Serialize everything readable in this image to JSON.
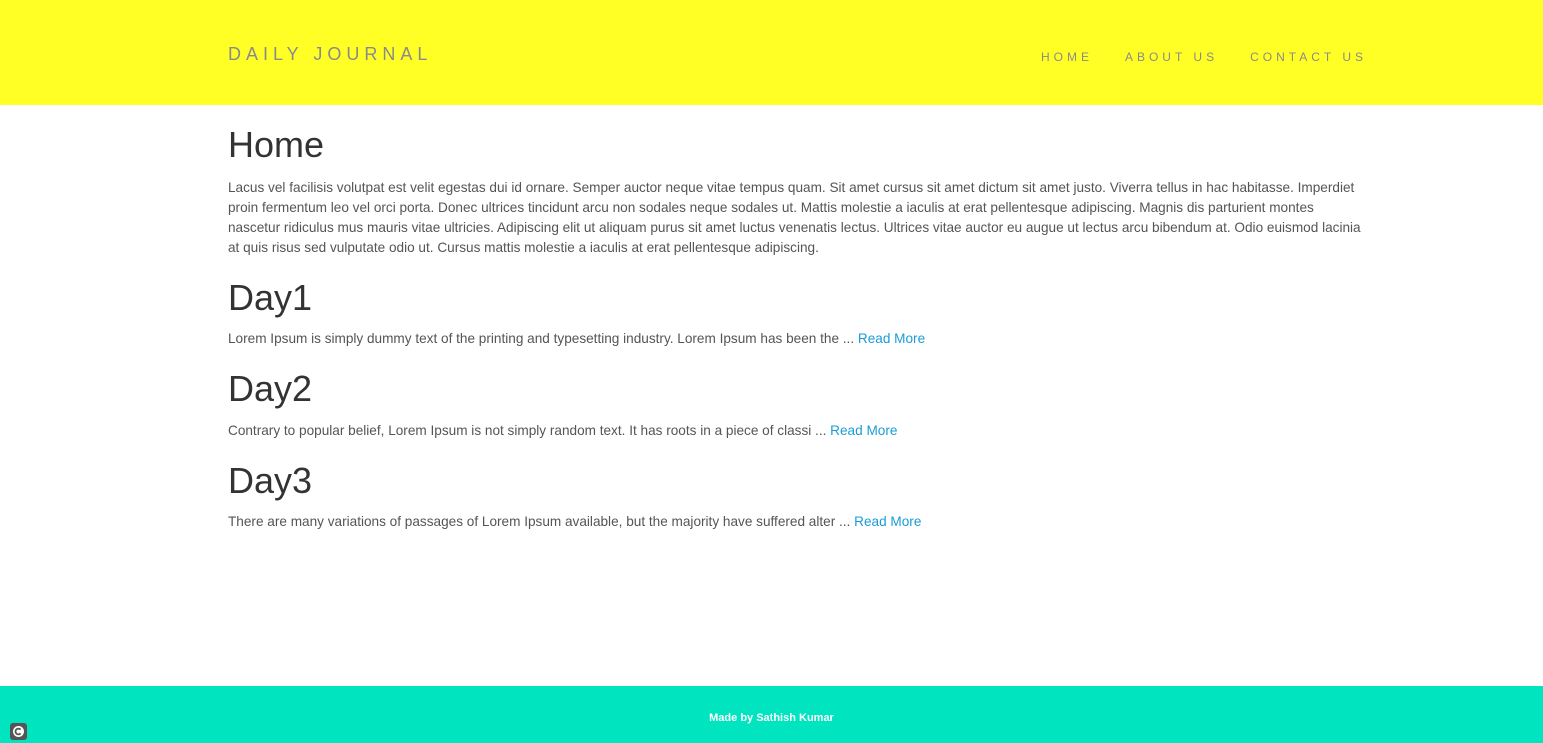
{
  "header": {
    "brand": "DAILY JOURNAL",
    "nav": [
      {
        "label": "HOME"
      },
      {
        "label": "ABOUT US"
      },
      {
        "label": "CONTACT US"
      }
    ]
  },
  "home": {
    "title": "Home",
    "text": "Lacus vel facilisis volutpat est velit egestas dui id ornare. Semper auctor neque vitae tempus quam. Sit amet cursus sit amet dictum sit amet justo. Viverra tellus in hac habitasse. Imperdiet proin fermentum leo vel orci porta. Donec ultrices tincidunt arcu non sodales neque sodales ut. Mattis molestie a iaculis at erat pellentesque adipiscing. Magnis dis parturient montes nascetur ridiculus mus mauris vitae ultricies. Adipiscing elit ut aliquam purus sit amet luctus venenatis lectus. Ultrices vitae auctor eu augue ut lectus arcu bibendum at. Odio euismod lacinia at quis risus sed vulputate odio ut. Cursus mattis molestie a iaculis at erat pellentesque adipiscing."
  },
  "posts": [
    {
      "title": "Day1",
      "excerpt": "Lorem Ipsum is simply dummy text of the printing and typesetting industry. Lorem Ipsum has been the ... ",
      "link": "Read More"
    },
    {
      "title": "Day2",
      "excerpt": "Contrary to popular belief, Lorem Ipsum is not simply random text. It has roots in a piece of classi ... ",
      "link": "Read More"
    },
    {
      "title": "Day3",
      "excerpt": "There are many variations of passages of Lorem Ipsum available, but the majority have suffered alter ... ",
      "link": "Read More"
    }
  ],
  "footer": {
    "text": "Made by Sathish Kumar"
  },
  "colors": {
    "header_bg": "#ffff26",
    "footer_bg": "#00e5c0",
    "link": "#1a9cd6"
  },
  "icons": {
    "corner": "copyright-icon"
  }
}
